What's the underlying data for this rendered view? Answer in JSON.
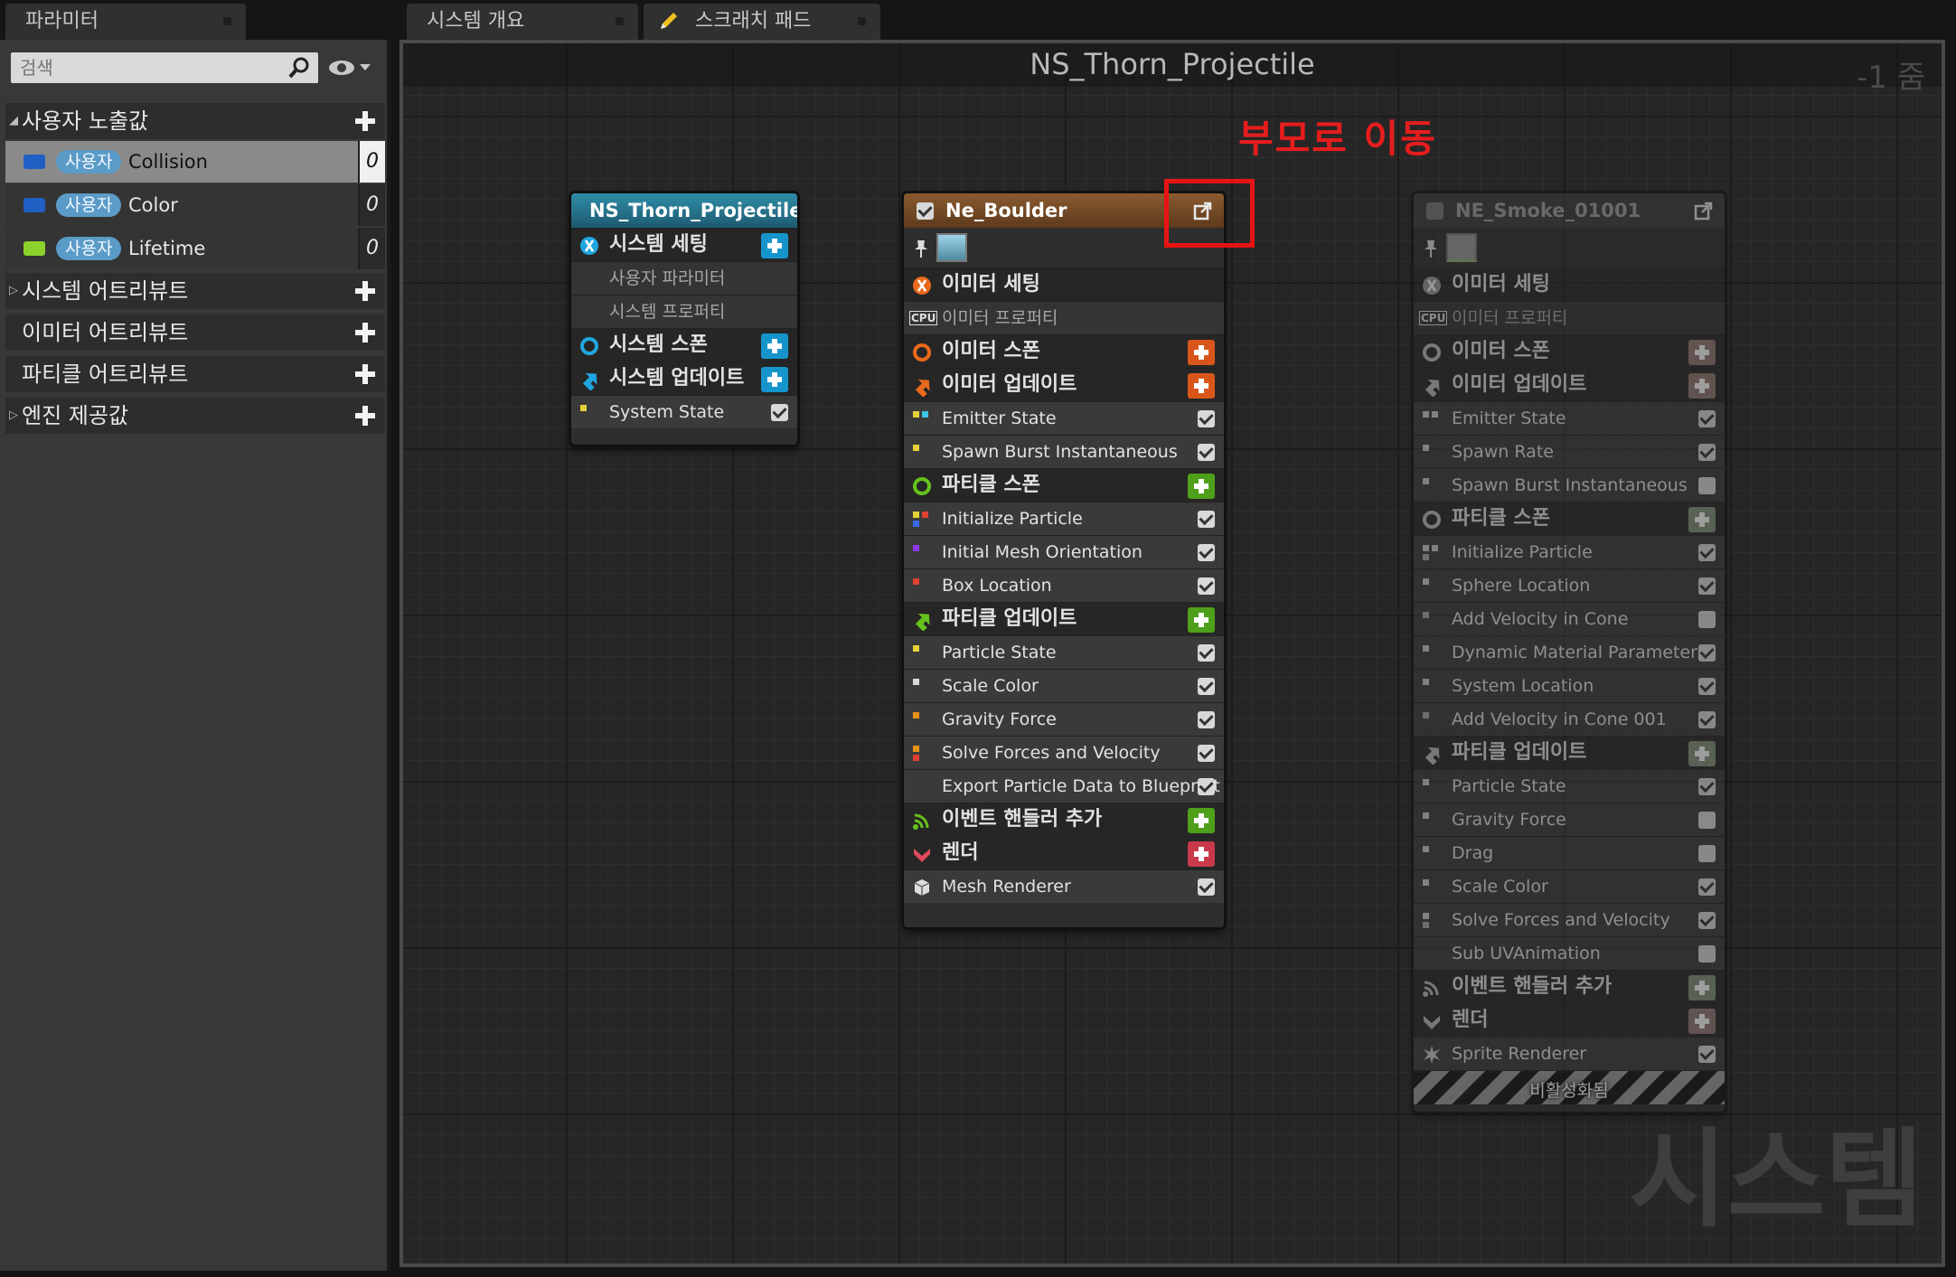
{
  "tabs": [
    {
      "label": "파라미터"
    },
    {
      "label": "시스템 개요"
    },
    {
      "label": "스크래치 패드"
    }
  ],
  "params": {
    "search_placeholder": "검색",
    "user_section": "사용자 노출값",
    "items": [
      {
        "badge": "사용자",
        "name": "Collision",
        "value": "0",
        "color": "#1f5fc4"
      },
      {
        "badge": "사용자",
        "name": "Color",
        "value": "0",
        "color": "#1f5fc4"
      },
      {
        "badge": "사용자",
        "name": "Lifetime",
        "value": "0",
        "color": "#8bd22c"
      }
    ],
    "sections": [
      {
        "label": "시스템 어트리뷰트"
      },
      {
        "label": "이미터 어트리뷰트"
      },
      {
        "label": "파티클 어트리뷰트"
      },
      {
        "label": "엔진 제공값"
      }
    ]
  },
  "graph": {
    "title": "NS_Thorn_Projectile",
    "zoom": "-1 줌",
    "annotation": "부모로 이동",
    "watermark": "시스템"
  },
  "system_node": {
    "title": "NS_Thorn_Projectile",
    "settings": "시스템 세팅",
    "user_params": "사용자 파라미터",
    "sys_props": "시스템 프로퍼티",
    "spawn": "시스템 스폰",
    "update": "시스템 업데이트",
    "state": "System State"
  },
  "emitter_node": {
    "title": "Ne_Boulder",
    "emitter_settings": "이미터 세팅",
    "emitter_props": "이미터 프로퍼티",
    "cpu": "CPU",
    "emitter_spawn": "이미터 스폰",
    "emitter_update": "이미터 업데이트",
    "m_emitter_state": "Emitter State",
    "m_spawn_burst": "Spawn Burst Instantaneous",
    "particle_spawn": "파티클 스폰",
    "m_init_particle": "Initialize Particle",
    "m_mesh_orient": "Initial Mesh Orientation",
    "m_box_loc": "Box Location",
    "particle_update": "파티클 업데이트",
    "m_particle_state": "Particle State",
    "m_scale_color": "Scale Color",
    "m_gravity": "Gravity Force",
    "m_solve": "Solve Forces and Velocity",
    "m_export": "Export Particle Data to Blueprint",
    "event_handler": "이벤트 핸들러 추가",
    "render": "렌더",
    "m_mesh_renderer": "Mesh Renderer"
  },
  "smoke_node": {
    "title": "NE_Smoke_01001",
    "emitter_settings": "이미터 세팅",
    "emitter_props": "이미터 프로퍼티",
    "cpu": "CPU",
    "emitter_spawn": "이미터 스폰",
    "emitter_update": "이미터 업데이트",
    "m_emitter_state": "Emitter State",
    "m_spawn_rate": "Spawn Rate",
    "m_spawn_burst": "Spawn Burst Instantaneous",
    "particle_spawn": "파티클 스폰",
    "m_init_particle": "Initialize Particle",
    "m_sphere_loc": "Sphere Location",
    "m_add_vel_cone": "Add Velocity in Cone",
    "m_dyn_mat": "Dynamic Material Parameters",
    "m_sys_loc": "System Location",
    "m_add_vel_cone2": "Add Velocity in Cone 001",
    "particle_update": "파티클 업데이트",
    "m_particle_state": "Particle State",
    "m_gravity": "Gravity Force",
    "m_drag": "Drag",
    "m_scale_color": "Scale Color",
    "m_solve": "Solve Forces and Velocity",
    "m_sub_uv": "Sub UVAnimation",
    "event_handler": "이벤트 핸들러 추가",
    "render": "렌더",
    "m_sprite_renderer": "Sprite Renderer",
    "disabled_label": "비활성화됨"
  }
}
